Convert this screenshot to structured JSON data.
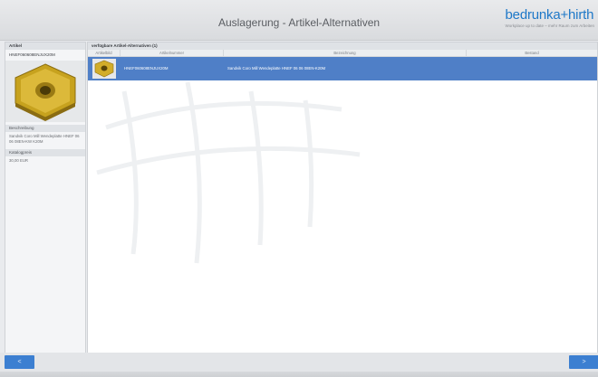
{
  "header": {
    "title": "Auslagerung - Artikel-Alternativen"
  },
  "logo": {
    "name": "bedrunka+hirth",
    "tagline": "Workplace up to date – mehr Raum zum Arbeiten"
  },
  "left_panel": {
    "title": "Artikel",
    "article_code": "HNEF060608ENJUX20M",
    "description_label": "Beschreibung",
    "description": "Sandvik Coro Mill Wendeplatte HNEF 06 06 08EN-KW K20M",
    "stock_label": "Katalogpreis",
    "stock_value": "30,00 EUR"
  },
  "main_panel": {
    "title": "verfügbare Artikel-Alternativen (1)",
    "columns": [
      "Artikelbild",
      "Artikelnummer",
      "Bezeichnung",
      "Bestand"
    ],
    "rows": [
      {
        "number": "HNEF060608ENJUX20M",
        "name": "Sandvik Coro Mill Wendeplatte HNEF 06 06 08EN-K20M",
        "stock": ""
      }
    ]
  },
  "footer": {
    "prev_label": "<",
    "next_label": ">"
  }
}
